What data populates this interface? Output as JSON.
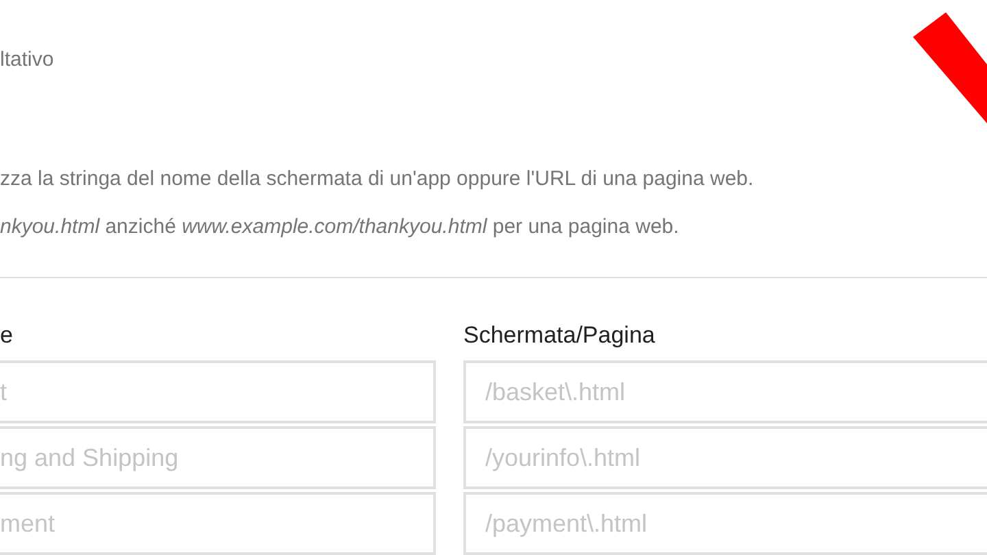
{
  "optional_label": "ltativo",
  "help": [
    "zza la stringa del nome della schermata di un'app oppure l'URL di una pagina web.",
    "*nkyou.html* anziché *www.example.com/thankyou.html* per una pagina web."
  ],
  "columns": [
    {
      "heading": "e"
    },
    {
      "heading": "Schermata/Pagina"
    }
  ],
  "steps": [
    {
      "name_placeholder": "t",
      "screen_placeholder": "/basket\\.html"
    },
    {
      "name_placeholder": "ng and Shipping",
      "screen_placeholder": "/yourinfo\\.html"
    },
    {
      "name_placeholder": "ment",
      "screen_placeholder": "/payment\\.html"
    }
  ]
}
